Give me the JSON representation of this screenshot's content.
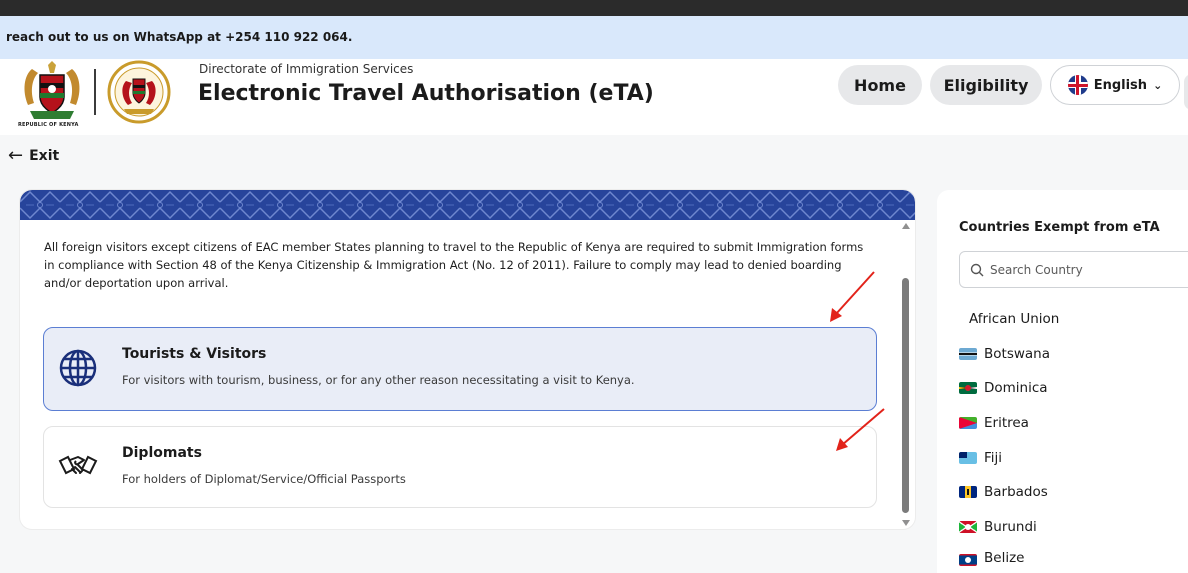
{
  "notice": {
    "text": "reach out to us on WhatsApp at +254 110 922 064."
  },
  "header": {
    "coat_caption": "REPUBLIC OF KENYA",
    "directorate": "Directorate of Immigration Services",
    "title": "Electronic Travel Authorisation (eTA)",
    "nav": {
      "home": "Home",
      "eligibility": "Eligibility"
    },
    "language": {
      "selected": "English"
    }
  },
  "exit": {
    "label": "Exit"
  },
  "main": {
    "intro": "All foreign visitors except citizens of EAC member States planning to travel to the Republic of Kenya are required to submit Immigration forms in compliance with Section 48 of the Kenya Citizenship & Immigration Act (No. 12 of 2011). Failure to comply may lead to denied boarding and/or deportation upon arrival.",
    "options": [
      {
        "title": "Tourists & Visitors",
        "description": "For visitors with tourism, business, or for any other reason necessitating a visit to Kenya."
      },
      {
        "title": "Diplomats",
        "description": "For holders of Diplomat/Service/Official Passports"
      }
    ]
  },
  "sidebar": {
    "title": "Countries Exempt from eTA",
    "search": {
      "placeholder": "Search Country"
    },
    "group_label": "African Union",
    "countries": [
      {
        "name": "Botswana"
      },
      {
        "name": "Dominica"
      },
      {
        "name": "Eritrea"
      },
      {
        "name": "Fiji"
      },
      {
        "name": "Barbados"
      },
      {
        "name": "Burundi"
      },
      {
        "name": "Belize"
      }
    ]
  },
  "colors": {
    "banner": "#27449b",
    "selected_border": "#5b7ed3",
    "selected_bg": "#e9edf7",
    "notice_bg": "#d9e8fb",
    "annotation_arrow": "#e2231a"
  }
}
